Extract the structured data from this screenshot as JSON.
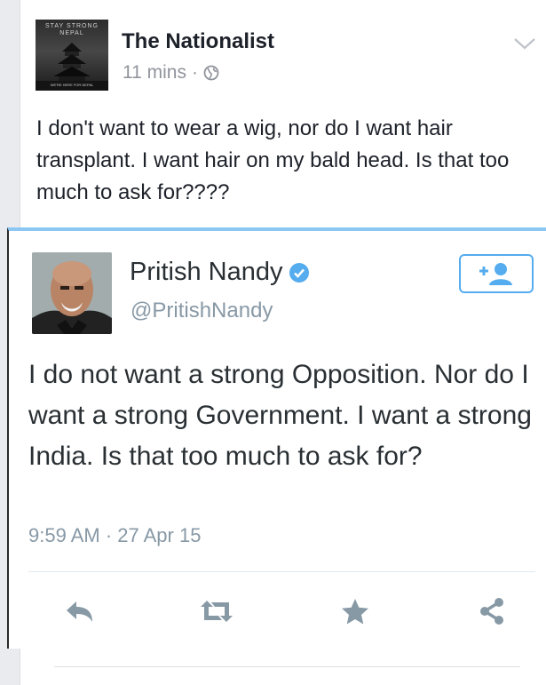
{
  "post": {
    "page_name": "The Nationalist",
    "time": "11 mins",
    "separator": "·",
    "avatar_text_top": "STAY STRONG NEPAL",
    "avatar_text_bottom": "WE'RE HERE FOR NEPAL",
    "text": "I don't want to wear a wig, nor do I want hair transplant. I want hair on my bald head. Is that too much to ask for????"
  },
  "tweet": {
    "name": "Pritish Nandy",
    "handle": "@PritishNandy",
    "text": "I do not want a strong Opposition. Nor do I want a strong Government. I want a strong India. Is that too much to ask for?",
    "timestamp": "9:59 AM · 27 Apr 15",
    "accent_color": "#55acee",
    "icons": [
      "reply-icon",
      "retweet-icon",
      "favorite-icon",
      "share-icon"
    ]
  }
}
